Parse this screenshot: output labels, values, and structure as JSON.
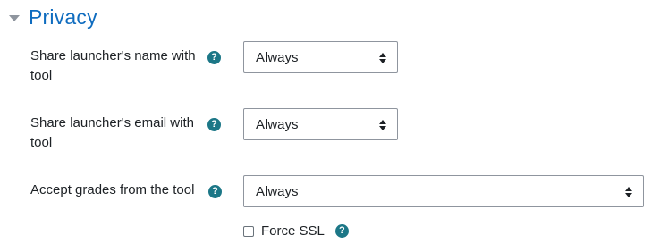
{
  "section": {
    "title": "Privacy"
  },
  "fields": [
    {
      "label": "Share launcher's name with tool",
      "value": "Always"
    },
    {
      "label": "Share launcher's email with tool",
      "value": "Always"
    },
    {
      "label": "Accept grades from the tool",
      "value": "Always"
    }
  ],
  "force_ssl": {
    "label": "Force SSL",
    "checked": false
  },
  "help_icon_glyph": "?",
  "colors": {
    "title": "#0f6cbf",
    "help_icon": "#1c7787",
    "border": "#8f959e"
  }
}
